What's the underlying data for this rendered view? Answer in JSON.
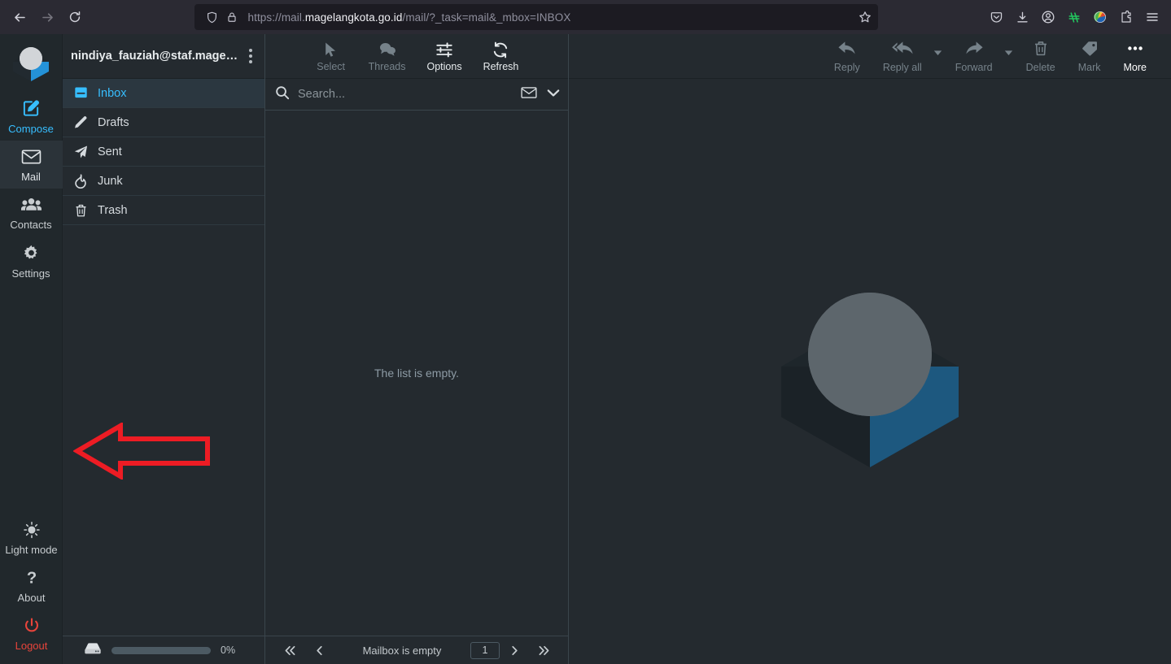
{
  "browser": {
    "back_icon": "back-arrow-icon",
    "forward_icon": "forward-arrow-icon",
    "reload_icon": "reload-icon",
    "url_prefix": "https://mail.",
    "url_domain": "magelangkota.go.id",
    "url_suffix": "/mail/?_task=mail&_mbox=INBOX",
    "url_full": "https://mail.magelangkota.go.id/mail/?_task=mail&_mbox=INBOX",
    "shield_icon": "tracking-protection-shield-icon",
    "lock_icon": "padlock-icon",
    "bookmark_icon": "star-bookmark-icon",
    "toolbar_icons": [
      "pocket-icon",
      "downloads-icon",
      "account-icon",
      "extension-green-icon",
      "extension-globe-icon",
      "extensions-puzzle-icon",
      "application-menu-icon"
    ]
  },
  "taskbar": {
    "logo_icon": "roundcube-logo-icon",
    "items": [
      {
        "label": "Compose",
        "icon": "compose-pencil-icon"
      },
      {
        "label": "Mail",
        "icon": "envelope-icon"
      },
      {
        "label": "Contacts",
        "icon": "contacts-people-icon"
      },
      {
        "label": "Settings",
        "icon": "gear-icon"
      }
    ],
    "bottom_items": [
      {
        "label": "Light mode",
        "icon": "sun-icon"
      },
      {
        "label": "About",
        "icon": "question-mark-icon"
      },
      {
        "label": "Logout",
        "icon": "power-icon"
      }
    ]
  },
  "folders": {
    "account": "nindiya_fauziah@staf.magelan…",
    "kebab_icon": "more-options-icon",
    "items": [
      {
        "label": "Inbox",
        "icon": "inbox-icon",
        "selected": true
      },
      {
        "label": "Drafts",
        "icon": "pencil-icon",
        "selected": false
      },
      {
        "label": "Sent",
        "icon": "paper-plane-icon",
        "selected": false
      },
      {
        "label": "Junk",
        "icon": "flame-icon",
        "selected": false
      },
      {
        "label": "Trash",
        "icon": "trash-icon",
        "selected": false
      }
    ],
    "quota": {
      "icon": "disk-quota-icon",
      "percent_label": "0%",
      "percent_value": 0
    },
    "annotation": {
      "shape": "red-left-arrow",
      "color": "#ed1c24"
    }
  },
  "list": {
    "toolbar": [
      {
        "label": "Select",
        "icon": "cursor-arrow-icon",
        "enabled": false
      },
      {
        "label": "Threads",
        "icon": "threads-bubbles-icon",
        "enabled": false
      },
      {
        "label": "Options",
        "icon": "sliders-options-icon",
        "enabled": true
      },
      {
        "label": "Refresh",
        "icon": "refresh-icon",
        "enabled": true
      }
    ],
    "search": {
      "placeholder": "Search...",
      "value": "",
      "search_icon": "search-icon",
      "scope_icon": "envelope-icon",
      "dropdown_icon": "chevron-down-icon"
    },
    "empty_message": "The list is empty.",
    "footer": {
      "first_icon": "first-page-icon",
      "prev_icon": "previous-page-icon",
      "status": "Mailbox is empty",
      "page_value": "1",
      "next_icon": "next-page-icon",
      "last_icon": "last-page-icon"
    }
  },
  "message": {
    "toolbar": [
      {
        "label": "Reply",
        "icon": "reply-icon",
        "enabled": false,
        "caret": false
      },
      {
        "label": "Reply all",
        "icon": "reply-all-icon",
        "enabled": false,
        "caret": true
      },
      {
        "label": "Forward",
        "icon": "forward-icon",
        "enabled": false,
        "caret": true
      },
      {
        "label": "Delete",
        "icon": "trash-icon",
        "enabled": false,
        "caret": false
      },
      {
        "label": "Mark",
        "icon": "tag-icon",
        "enabled": false,
        "caret": false
      },
      {
        "label": "More",
        "icon": "more-dots-icon",
        "enabled": true,
        "caret": false
      }
    ],
    "watermark_icon": "roundcube-logo-watermark"
  },
  "colors": {
    "accent": "#37beff",
    "logout": "#e8443b",
    "annotation": "#ed1c24",
    "page_bg": "#242a2f",
    "chrome_bg": "#2b2a33"
  }
}
